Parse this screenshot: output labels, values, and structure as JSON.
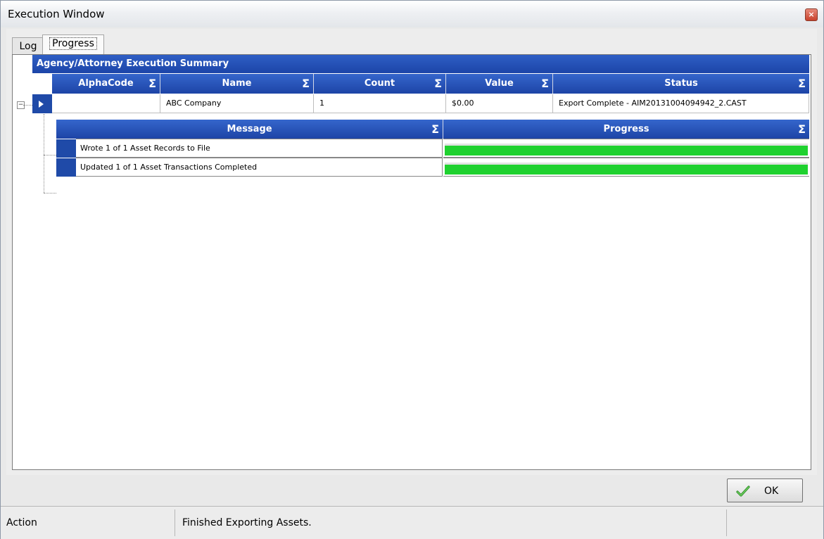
{
  "window": {
    "title": "Execution Window",
    "close_glyph": "×"
  },
  "tabs": [
    {
      "label": "Log",
      "active": false
    },
    {
      "label": "Progress",
      "active": true
    }
  ],
  "grid": {
    "band_title": "Agency/Attorney Execution Summary",
    "sigma": "Σ",
    "columns": [
      "AlphaCode",
      "Name",
      "Count",
      "Value",
      "Status"
    ],
    "rows": [
      {
        "alphacode": "",
        "name": "ABC Company",
        "count": "1",
        "value": "$0.00",
        "status": "Export Complete - AIM20131004094942_2.CAST",
        "expanded": true
      }
    ],
    "detail": {
      "columns": [
        "Message",
        "Progress"
      ],
      "rows": [
        {
          "message": "Wrote 1 of 1 Asset Records to File",
          "progress": 1.0
        },
        {
          "message": "Updated 1 of 1 Asset Transactions Completed",
          "progress": 1.0
        }
      ]
    }
  },
  "colors": {
    "header_blue": "#1d44a6",
    "progress_green": "#1fd12f"
  },
  "buttons": {
    "ok_label": "OK",
    "ok_icon": "checkmark-icon"
  },
  "status": {
    "label": "Action",
    "message": "Finished Exporting Assets.",
    "extra": ""
  }
}
